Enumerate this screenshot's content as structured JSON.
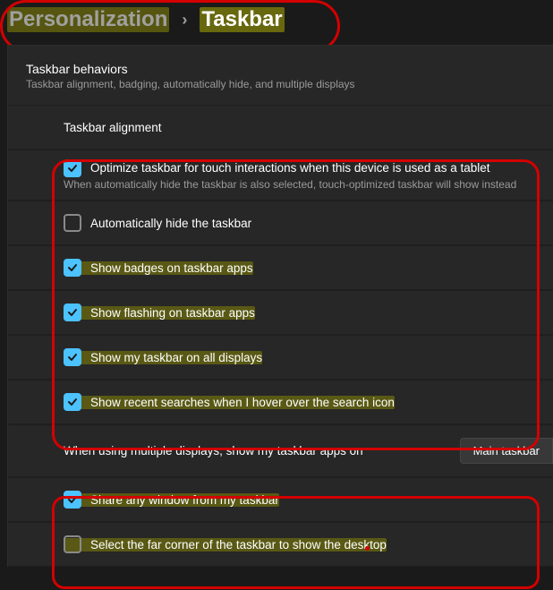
{
  "breadcrumb": {
    "parent": "Personalization",
    "chevron": "›",
    "current": "Taskbar"
  },
  "section": {
    "title": "Taskbar behaviors",
    "subtitle": "Taskbar alignment, badging, automatically hide, and multiple displays"
  },
  "rows": {
    "alignment_label": "Taskbar alignment",
    "optimize": {
      "label": "Optimize taskbar for touch interactions when this device is used as a tablet",
      "sub": "When automatically hide the taskbar is also selected, touch-optimized taskbar will show instead"
    },
    "autohide": "Automatically hide the taskbar",
    "badges": "Show badges on taskbar apps",
    "flashing": "Show flashing on taskbar apps",
    "all_displays": "Show my taskbar on all displays",
    "recent_searches": "Show recent searches when I hover over the search icon",
    "multi_display_label": "When using multiple displays, show my taskbar apps on",
    "multi_display_value": "Main taskbar",
    "share_window": "Share any window from my taskbar",
    "far_corner": "Select the far corner of the taskbar to show the desktop"
  }
}
